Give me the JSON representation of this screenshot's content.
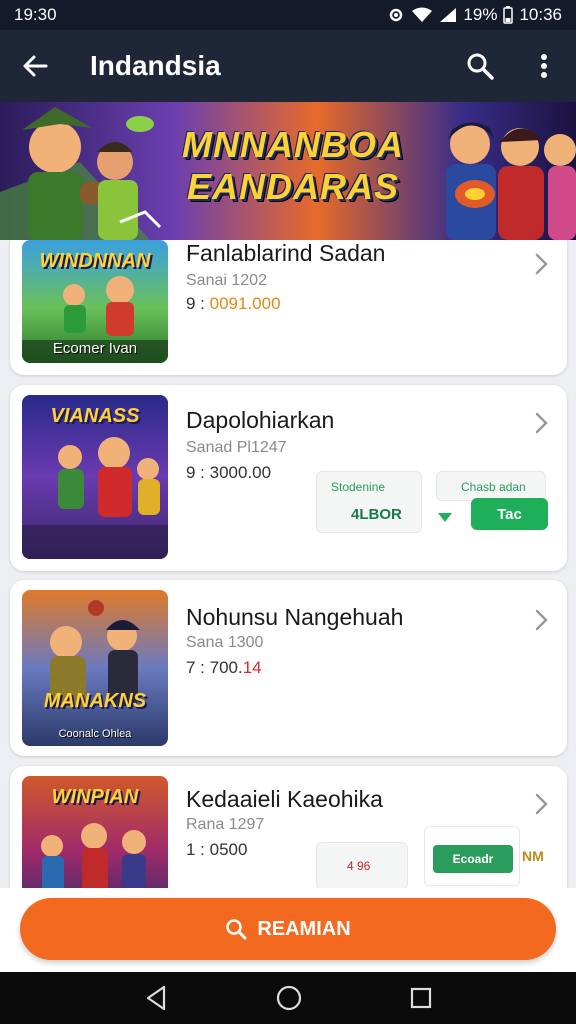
{
  "status": {
    "time": "19:30",
    "battery": "19%",
    "clock": "10:36"
  },
  "appbar": {
    "title": "Indandsia"
  },
  "banner": {
    "line1": "MNNANBOA",
    "line2": "EANDARAS"
  },
  "items": [
    {
      "title": "Fanlablarind Sadan",
      "sub": "Sanai 1202",
      "price_prefix": "9 : ",
      "price": "0091.000",
      "thumb_title": "WINDNNAN",
      "thumb_caption": "Ecomer Ivan"
    },
    {
      "title": "Dapolohiarkan",
      "sub": "Sanad Pl1247",
      "price_prefix": "9 : ",
      "price": "3000.00",
      "thumb_title": "VIANASS",
      "thumb_caption": "",
      "mini1_label": "Stodenine",
      "mini1_value": "4LBOR",
      "mini2_label": "Chasb adan",
      "mini2_value": "Tac"
    },
    {
      "title": "Nohunsu Nangehuah",
      "sub": "Sana 1300",
      "price_prefix": "7 : ",
      "price": "700.",
      "price_accent": "14",
      "thumb_title": "MANAKNS",
      "thumb_caption": "Coonalc Ohlea"
    },
    {
      "title": "Kedaaieli Kaeohika",
      "sub": "Rana 1297",
      "price_prefix": "1 : ",
      "price": "0500",
      "thumb_title": "WINPIAN",
      "thumb_caption": "",
      "mini1_value": "4 96",
      "mini2_label": "Ecoadr",
      "mini2_value": "NM"
    }
  ],
  "cta": {
    "label": "REAMIAN"
  },
  "colors": {
    "accent": "#f2691f",
    "appbar": "#1f2638",
    "green": "#1fae5a"
  },
  "icons": [
    "back-arrow-icon",
    "search-icon",
    "more-vert-icon",
    "chevron-right-icon",
    "search-icon",
    "nav-back-icon",
    "nav-home-icon",
    "nav-recents-icon"
  ]
}
